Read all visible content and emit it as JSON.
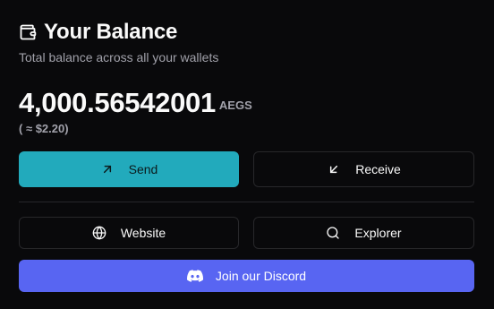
{
  "header": {
    "title": "Your Balance",
    "subtitle": "Total balance across all your wallets",
    "icon": "wallet-icon"
  },
  "balance": {
    "amount": "4,000.56542001",
    "unit": "AEGS",
    "usd": "( ≈ $2.20)"
  },
  "actions": {
    "send_label": "Send",
    "receive_label": "Receive",
    "website_label": "Website",
    "explorer_label": "Explorer",
    "discord_label": "Join our Discord"
  },
  "colors": {
    "background": "#09090b",
    "send": "#22aabc",
    "discord": "#5865f2",
    "muted_text": "#a1a1aa",
    "border": "#27272a"
  }
}
